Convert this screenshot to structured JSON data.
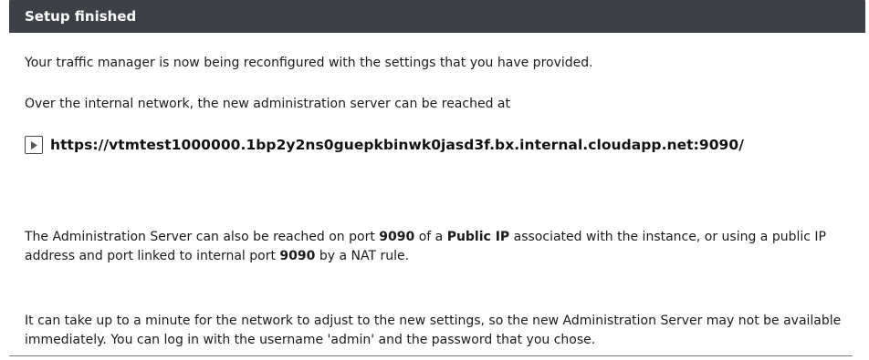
{
  "header": {
    "title": "Setup finished"
  },
  "body": {
    "p1": "Your traffic manager is now being reconfigured with the settings that you have provided.",
    "p2": "Over the internal network, the new administration server can be reached at",
    "url": {
      "icon": "play-icon",
      "text": "https://vtmtest1000000.1bp2y2ns0guepkbinwk0jasd3f.bx.internal.cloudapp.net:9090/"
    },
    "p3": {
      "part1": "The Administration Server can also be reached on port ",
      "port1": "9090",
      "part2": " of a ",
      "public_ip": "Public IP",
      "part3": " associated with the instance, or using a public IP address and port linked to internal port ",
      "port2": "9090",
      "part4": " by a NAT rule."
    },
    "p4": "It can take up to a minute for the network to adjust to the new settings, so the new Administration Server may not be available immediately. You can log in with the username 'admin' and the password that you chose."
  }
}
